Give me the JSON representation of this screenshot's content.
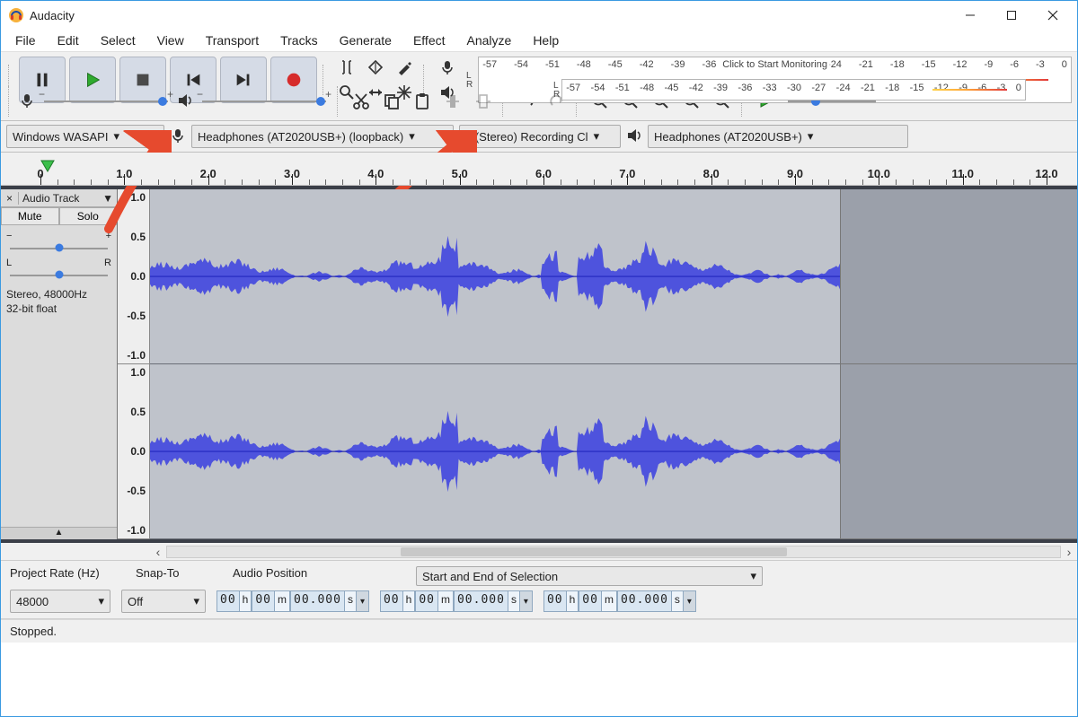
{
  "window": {
    "title": "Audacity"
  },
  "menu": [
    "File",
    "Edit",
    "Select",
    "View",
    "Transport",
    "Tracks",
    "Generate",
    "Effect",
    "Analyze",
    "Help"
  ],
  "meters": {
    "ticks": [
      "-57",
      "-54",
      "-51",
      "-48",
      "-45",
      "-42",
      "-39",
      "-36",
      "-33",
      "-30",
      "-27",
      "-24",
      "-21",
      "-18",
      "-15",
      "-12",
      "-9",
      "-6",
      "-3",
      "0"
    ],
    "rec_hint": "Click to Start Monitoring",
    "lr": [
      "L",
      "R"
    ]
  },
  "devices": {
    "host": "Windows WASAPI",
    "rec_device": "Headphones (AT2020USB+) (loopback)",
    "rec_channels": "2 (Stereo) Recording Cl",
    "play_device": "Headphones (AT2020USB+)"
  },
  "timeline": {
    "labels": [
      "0",
      "1.0",
      "2.0",
      "3.0",
      "4.0",
      "5.0",
      "6.0",
      "7.0",
      "8.0",
      "9.0",
      "10.0",
      "11.0",
      "12.0"
    ]
  },
  "track": {
    "name": "Audio Track",
    "close": "×",
    "menu_glyph": "▼",
    "mute": "Mute",
    "solo": "Solo",
    "pan_left": "L",
    "pan_right": "R",
    "gain_minus": "−",
    "gain_plus": "+",
    "info1": "Stereo, 48000Hz",
    "info2": "32-bit float",
    "y_ticks": [
      "1.0",
      "0.5",
      "0.0",
      "-0.5",
      "-1.0"
    ],
    "collapse_glyph": "▲"
  },
  "selection": {
    "rate_label": "Project Rate (Hz)",
    "rate_value": "48000",
    "snap_label": "Snap-To",
    "snap_value": "Off",
    "pos_label": "Audio Position",
    "range_label": "Start and End of Selection",
    "tc": {
      "hh": "00",
      "h": "h",
      "mm": "00",
      "m": "m",
      "ss": "00.000",
      "s": "s"
    }
  },
  "status": {
    "text": "Stopped."
  },
  "slider_glyphs": {
    "minus": "−",
    "plus": "+"
  },
  "scroll_glyphs": {
    "left": "‹",
    "right": "›"
  }
}
